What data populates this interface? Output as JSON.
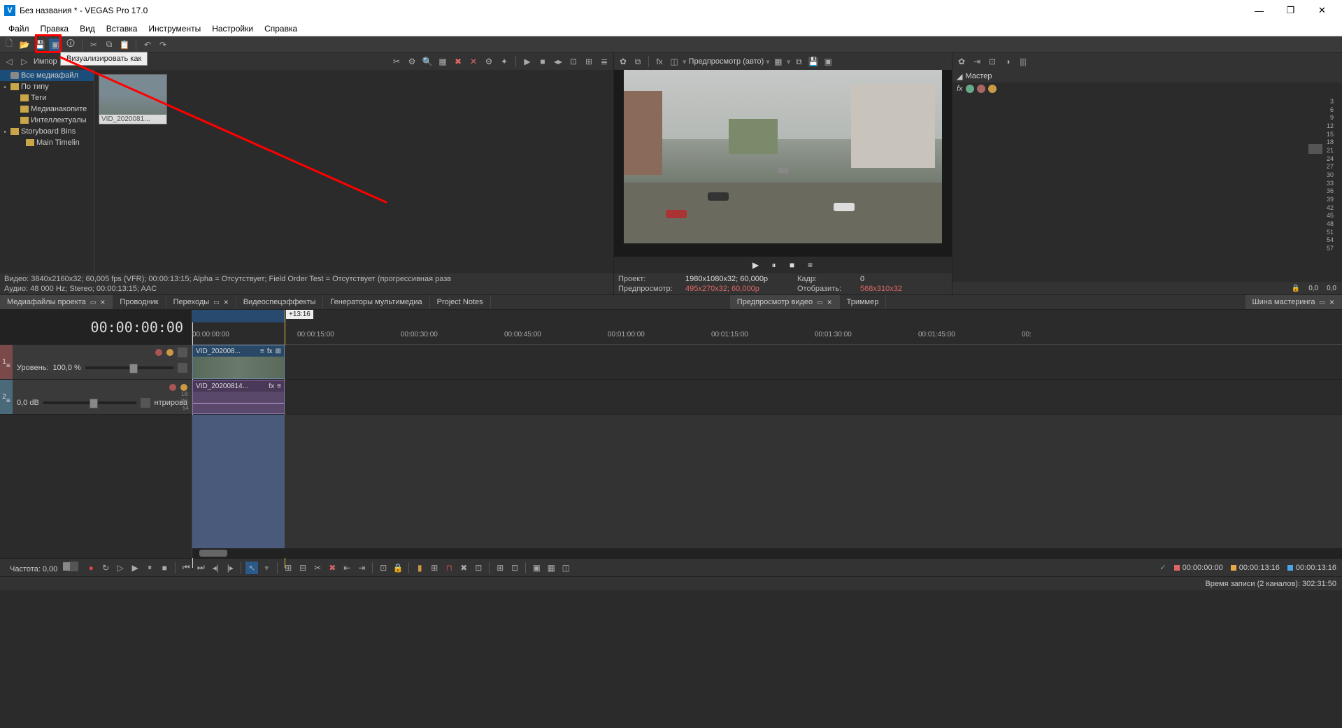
{
  "title": "Без названия * - VEGAS Pro 17.0",
  "logo_letter": "V",
  "menubar": [
    "Файл",
    "Правка",
    "Вид",
    "Вставка",
    "Инструменты",
    "Настройки",
    "Справка"
  ],
  "tooltip": "Визуализировать как",
  "media_panel": {
    "import_label": "Импор",
    "tree": [
      {
        "label": "Все медиафайл",
        "icon": "db",
        "depth": 0,
        "expand": "",
        "sel": true
      },
      {
        "label": "По типу",
        "icon": "folder",
        "depth": 0,
        "expand": "+"
      },
      {
        "label": "Теги",
        "icon": "folder",
        "depth": 1,
        "expand": ""
      },
      {
        "label": "Медианакопите",
        "icon": "folder",
        "depth": 1,
        "expand": ""
      },
      {
        "label": "Интеллектуалы",
        "icon": "folder",
        "depth": 1,
        "expand": ""
      },
      {
        "label": "Storyboard Bins",
        "icon": "folder",
        "depth": 0,
        "expand": "-"
      },
      {
        "label": "Main Timelin",
        "icon": "folder",
        "depth": 1,
        "expand": ""
      }
    ],
    "thumb_caption": "VID_2020081...",
    "info_video": "Видео: 3840x2160x32; 60,005 fps (VFR); 00:00:13:15; Alpha = Отсутствует; Field Order Test = Отсутствует (прогрессивная разв",
    "info_audio": "Аудио: 48 000 Hz; Stereo; 00:00:13:15; AAC"
  },
  "preview_panel": {
    "quality_label": "Предпросмотр (авто)",
    "info": {
      "project_label": "Проект:",
      "project_val": "1980x1080x32; 60,000p",
      "frame_label": "Кадр:",
      "frame_val": "0",
      "preview_label": "Предпросмотр:",
      "preview_val": "495x270x32; 60,000p",
      "display_label": "Отобразить:",
      "display_val": "568x310x32"
    }
  },
  "master_panel": {
    "title": "Мастер",
    "db_marks": [
      "3",
      "6",
      "9",
      "12",
      "15",
      "18",
      "21",
      "24",
      "27",
      "30",
      "33",
      "36",
      "39",
      "42",
      "45",
      "48",
      "51",
      "54",
      "57"
    ],
    "bottom_left": "0,0",
    "bottom_right": "0,0"
  },
  "tabs_left": [
    {
      "label": "Медиафайлы проекта",
      "closable": true,
      "active": true
    },
    {
      "label": "Проводник"
    },
    {
      "label": "Переходы",
      "closable": true
    },
    {
      "label": "Видеоспецэффекты"
    },
    {
      "label": "Генераторы мультимедиа"
    },
    {
      "label": "Project Notes"
    }
  ],
  "tabs_mid": [
    {
      "label": "Предпросмотр видео",
      "closable": true,
      "active": true
    },
    {
      "label": "Триммер"
    }
  ],
  "tabs_right": [
    {
      "label": "Шина мастеринга",
      "closable": true,
      "active": true
    }
  ],
  "timeline": {
    "counter": "00:00:00:00",
    "badge": "+13:16",
    "ruler": [
      "00:00:00:00",
      "00:00:15:00",
      "00:00:30:00",
      "00:00:45:00",
      "00:01:00:00",
      "00:01:15:00",
      "00:01:30:00",
      "00:01:45:00",
      "00:"
    ],
    "video_track": {
      "num": "1",
      "level_label": "Уровень:",
      "level_val": "100,0 %",
      "clip_name": "VID_202008..."
    },
    "audio_track": {
      "num": "2",
      "db_label": "0,0 dB",
      "pan_label": "нтрирова",
      "clip_name": "VID_20200814...",
      "scale": [
        "18:",
        "36:",
        "54"
      ]
    }
  },
  "bottom": {
    "freq_label": "Частота: 0,00",
    "times": [
      {
        "color": "#d66",
        "val": "00:00:00:00"
      },
      {
        "color": "#e8a84a",
        "val": "00:00:13:16"
      },
      {
        "color": "#4aa4e8",
        "val": "00:00:13:16"
      }
    ]
  },
  "status": "Время записи (2 каналов): 302:31:50"
}
